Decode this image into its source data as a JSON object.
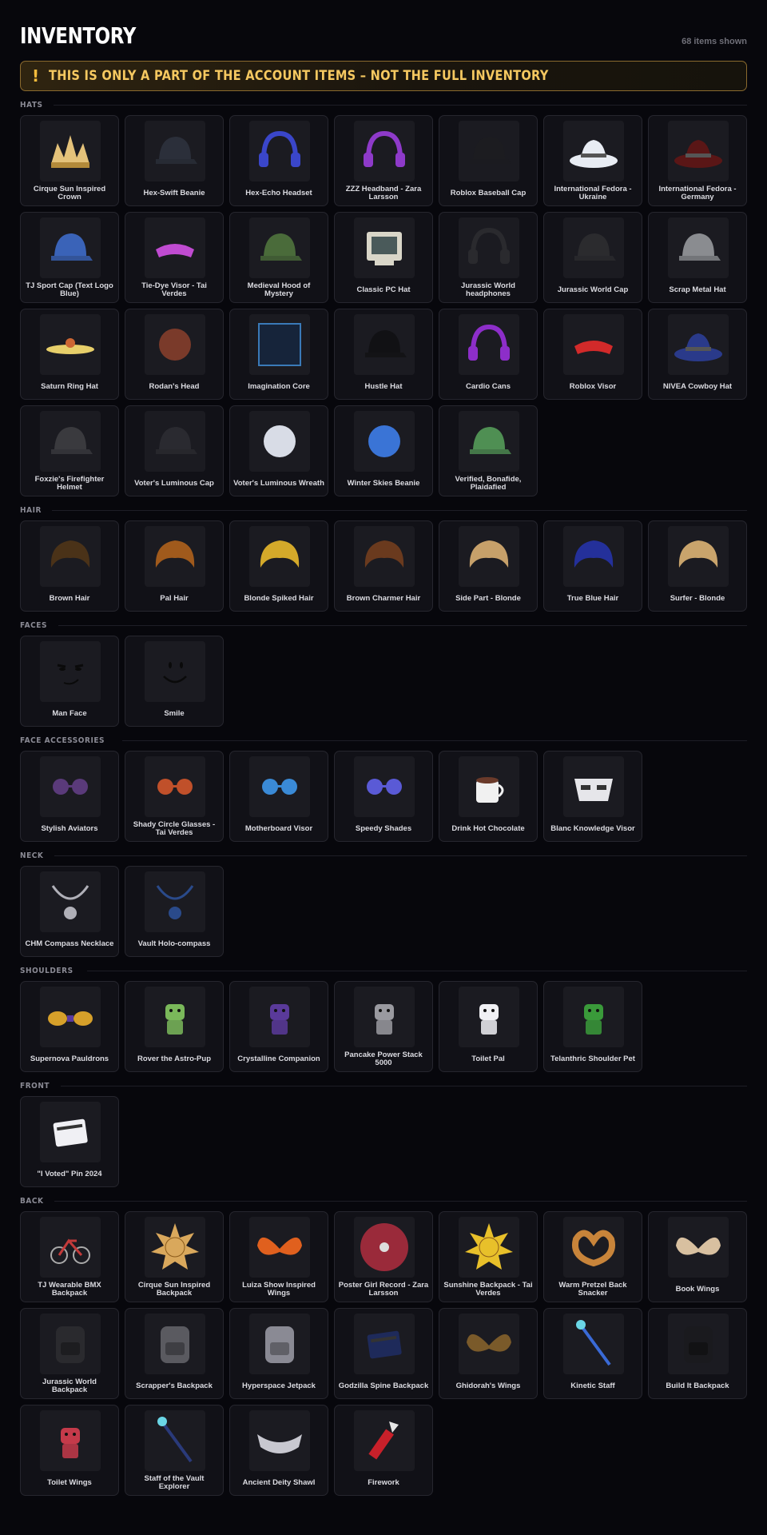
{
  "header": {
    "title": "INVENTORY",
    "items_shown": "68 items shown"
  },
  "banner": {
    "icon": "!",
    "text": "THIS IS ONLY A PART OF THE ACCOUNT ITEMS – NOT THE FULL INVENTORY"
  },
  "sections": [
    {
      "title": "HATS",
      "items": [
        {
          "name": "Cirque Sun Inspired Crown",
          "icon": "crown-icon",
          "color": "#e4c27a"
        },
        {
          "name": "Hex-Swift Beanie",
          "icon": "beanie-icon",
          "color": "#2b2f3a"
        },
        {
          "name": "Hex-Echo Headset",
          "icon": "headset-icon",
          "color": "#3a46c9"
        },
        {
          "name": "ZZZ Headband - Zara Larsson",
          "icon": "headband-icon",
          "color": "#8e3ac9"
        },
        {
          "name": "Roblox Baseball Cap",
          "icon": "cap-icon",
          "color": "#1c1c20"
        },
        {
          "name": "International Fedora - Ukraine",
          "icon": "fedora-icon",
          "color": "#e8ecf3"
        },
        {
          "name": "International Fedora - Germany",
          "icon": "fedora-icon",
          "color": "#5a1616"
        },
        {
          "name": "TJ Sport Cap (Text Logo Blue)",
          "icon": "cap-icon",
          "color": "#3a63b8"
        },
        {
          "name": "Tie-Dye Visor - Tai Verdes",
          "icon": "visor-icon",
          "color": "#c04bd1"
        },
        {
          "name": "Medieval Hood of Mystery",
          "icon": "hood-icon",
          "color": "#4a6b3a"
        },
        {
          "name": "Classic PC Hat",
          "icon": "computer-icon",
          "color": "#d9d6c8"
        },
        {
          "name": "Jurassic World headphones",
          "icon": "headphones-icon",
          "color": "#2a2a2e"
        },
        {
          "name": "Jurassic World Cap",
          "icon": "cap-icon",
          "color": "#2b2b2e"
        },
        {
          "name": "Scrap Metal Hat",
          "icon": "helmet-icon",
          "color": "#8a8c90"
        },
        {
          "name": "Saturn Ring Hat",
          "icon": "ring-icon",
          "color": "#e7cf6a"
        },
        {
          "name": "Rodan's Head",
          "icon": "dragon-head-icon",
          "color": "#7a3a2a"
        },
        {
          "name": "Imagination Core",
          "icon": "cube-icon",
          "color": "#16243a"
        },
        {
          "name": "Hustle Hat",
          "icon": "cap-icon",
          "color": "#111114"
        },
        {
          "name": "Cardio Cans",
          "icon": "earmuffs-icon",
          "color": "#8d2ec9"
        },
        {
          "name": "Roblox Visor",
          "icon": "visor-icon",
          "color": "#d22a2a"
        },
        {
          "name": "NIVEA Cowboy Hat",
          "icon": "cowboy-hat-icon",
          "color": "#2a3a8a"
        },
        {
          "name": "Foxzie's Firefighter Helmet",
          "icon": "firefighter-helmet-icon",
          "color": "#3a3a3e"
        },
        {
          "name": "Voter's Luminous Cap",
          "icon": "cap-icon",
          "color": "#2a2a30"
        },
        {
          "name": "Voter's Luminous Wreath",
          "icon": "wreath-icon",
          "color": "#d8dce6"
        },
        {
          "name": "Winter Skies Beanie",
          "icon": "cloud-hat-icon",
          "color": "#3a74d6"
        },
        {
          "name": "Verified, Bonafide, Plaidafied",
          "icon": "plaid-cap-icon",
          "color": "#4f8f53"
        }
      ]
    },
    {
      "title": "HAIR",
      "items": [
        {
          "name": "Brown Hair",
          "icon": "hair-icon",
          "color": "#4a3218"
        },
        {
          "name": "Pal Hair",
          "icon": "hair-icon",
          "color": "#a05a1c"
        },
        {
          "name": "Blonde Spiked Hair",
          "icon": "hair-icon",
          "color": "#d4a92a"
        },
        {
          "name": "Brown Charmer Hair",
          "icon": "hair-icon",
          "color": "#6a3a1e"
        },
        {
          "name": "Side Part - Blonde",
          "icon": "hair-icon",
          "color": "#c6a06a"
        },
        {
          "name": "True Blue Hair",
          "icon": "hair-icon",
          "color": "#24309a"
        },
        {
          "name": "Surfer - Blonde",
          "icon": "hair-icon",
          "color": "#c9a46c"
        }
      ]
    },
    {
      "title": "FACES",
      "items": [
        {
          "name": "Man Face",
          "icon": "man-face-icon",
          "color": "#0a0a0a"
        },
        {
          "name": "Smile",
          "icon": "smile-face-icon",
          "color": "#0a0a0a"
        }
      ]
    },
    {
      "title": "FACE ACCESSORIES",
      "items": [
        {
          "name": "Stylish Aviators",
          "icon": "sunglasses-icon",
          "color": "#5a3a7a"
        },
        {
          "name": "Shady Circle Glasses - Tai Verdes",
          "icon": "round-glasses-icon",
          "color": "#c0502a"
        },
        {
          "name": "Motherboard Visor",
          "icon": "visor-glasses-icon",
          "color": "#3a8ad6"
        },
        {
          "name": "Speedy Shades",
          "icon": "shades-icon",
          "color": "#5a5ad6"
        },
        {
          "name": "Drink Hot Chocolate",
          "icon": "mug-icon",
          "color": "#f1f1f1"
        },
        {
          "name": "Blanc Knowledge Visor",
          "icon": "mask-icon",
          "color": "#e6e6ea"
        }
      ]
    },
    {
      "title": "NECK",
      "items": [
        {
          "name": "CHM Compass Necklace",
          "icon": "necklace-icon",
          "color": "#b0b0b8"
        },
        {
          "name": "Vault Holo-compass",
          "icon": "pendant-icon",
          "color": "#2a4a8a"
        }
      ]
    },
    {
      "title": "SHOULDERS",
      "items": [
        {
          "name": "Supernova Pauldrons",
          "icon": "pauldrons-icon",
          "color": "#d6a02a"
        },
        {
          "name": "Rover the Astro-Pup",
          "icon": "pet-icon",
          "color": "#7ab85a"
        },
        {
          "name": "Crystalline Companion",
          "icon": "crystal-pet-icon",
          "color": "#5a3a9a"
        },
        {
          "name": "Pancake Power Stack 5000",
          "icon": "pancake-icon",
          "color": "#9a9aa0"
        },
        {
          "name": "Toilet Pal",
          "icon": "toilet-icon",
          "color": "#f0f0f4"
        },
        {
          "name": "Telanthric Shoulder Pet",
          "icon": "robot-pet-icon",
          "color": "#3a9a3a"
        }
      ]
    },
    {
      "title": "FRONT",
      "items": [
        {
          "name": "\"I Voted\" Pin 2024",
          "icon": "pin-icon",
          "color": "#f0f0f4"
        }
      ]
    },
    {
      "title": "BACK",
      "items": [
        {
          "name": "TJ Wearable BMX Backpack",
          "icon": "bike-icon",
          "color": "#c23a3a"
        },
        {
          "name": "Cirque Sun Inspired Backpack",
          "icon": "sun-icon",
          "color": "#d9a85c"
        },
        {
          "name": "Luiza Show Inspired Wings",
          "icon": "butterfly-wings-icon",
          "color": "#e0601e"
        },
        {
          "name": "Poster Girl Record - Zara Larsson",
          "icon": "record-icon",
          "color": "#9a2a3a"
        },
        {
          "name": "Sunshine Backpack - Tai Verdes",
          "icon": "sun-icon",
          "color": "#e8c02a"
        },
        {
          "name": "Warm Pretzel Back Snacker",
          "icon": "pretzel-icon",
          "color": "#c8843a"
        },
        {
          "name": "Book Wings",
          "icon": "book-wings-icon",
          "color": "#d8c0a0"
        },
        {
          "name": "Jurassic World Backpack",
          "icon": "backpack-icon",
          "color": "#2a2a2e"
        },
        {
          "name": "Scrapper's Backpack",
          "icon": "backpack-icon",
          "color": "#5a5a60"
        },
        {
          "name": "Hyperspace Jetpack",
          "icon": "jetpack-icon",
          "color": "#8a8a94"
        },
        {
          "name": "Godzilla Spine Backpack",
          "icon": "spine-backpack-icon",
          "color": "#1e2a5a"
        },
        {
          "name": "Ghidorah's Wings",
          "icon": "dragon-wings-icon",
          "color": "#7a5a2a"
        },
        {
          "name": "Kinetic Staff",
          "icon": "staff-icon",
          "color": "#3a6ad6"
        },
        {
          "name": "Build It Backpack",
          "icon": "backpack-icon",
          "color": "#1a1a1e"
        },
        {
          "name": "Toilet Wings",
          "icon": "toilet-wings-icon",
          "color": "#c43a4a"
        },
        {
          "name": "Staff of the Vault Explorer",
          "icon": "staff-icon",
          "color": "#2a3a7a"
        },
        {
          "name": "Ancient Deity Shawl",
          "icon": "shawl-icon",
          "color": "#c8c8d0"
        },
        {
          "name": "Firework",
          "icon": "firework-icon",
          "color": "#c8202a"
        }
      ]
    }
  ]
}
